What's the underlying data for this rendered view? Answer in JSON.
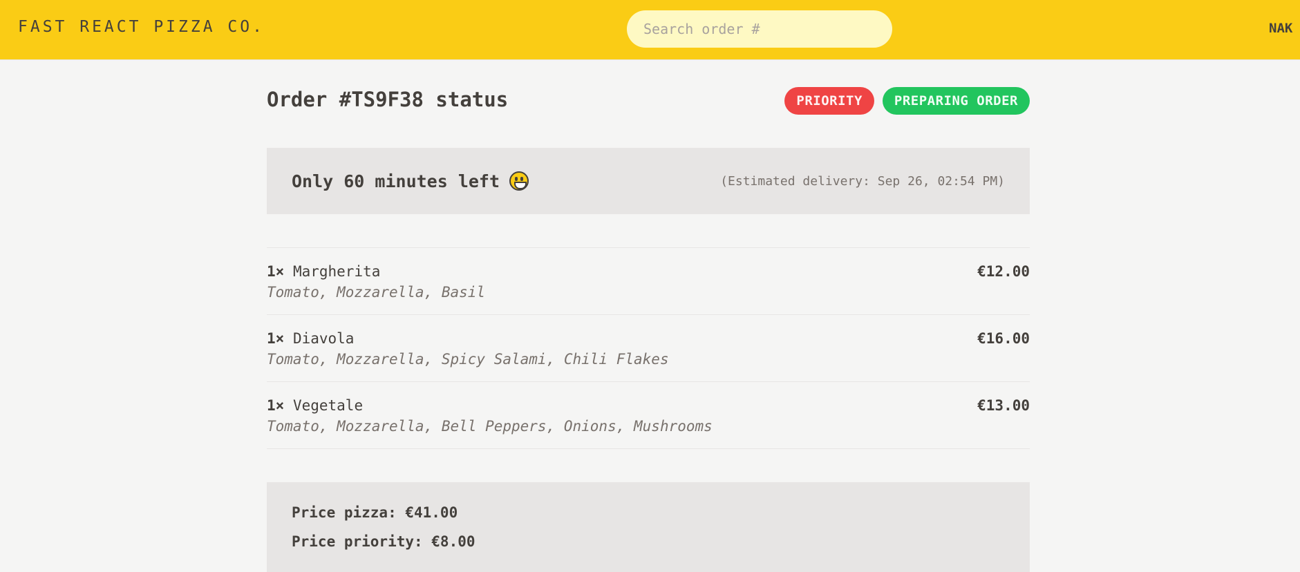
{
  "header": {
    "logo": "Fast React Pizza Co.",
    "search_placeholder": "Search order #",
    "username": "NAK"
  },
  "order": {
    "title": "Order #TS9F38 status",
    "badges": {
      "priority": "Priority",
      "status": "Preparing order"
    },
    "eta": {
      "text": "Only 60 minutes left",
      "icon": "smiley-icon",
      "estimate": "(Estimated delivery: Sep 26, 02:54 PM)"
    },
    "items": [
      {
        "qty": "1×",
        "name": "Margherita",
        "ingredients": "Tomato, Mozzarella, Basil",
        "price": "€12.00"
      },
      {
        "qty": "1×",
        "name": "Diavola",
        "ingredients": "Tomato, Mozzarella, Spicy Salami, Chili Flakes",
        "price": "€16.00"
      },
      {
        "qty": "1×",
        "name": "Vegetale",
        "ingredients": "Tomato, Mozzarella, Bell Peppers, Onions, Mushrooms",
        "price": "€13.00"
      }
    ],
    "totals": {
      "pizza": "Price pizza: €41.00",
      "priority": "Price priority: €8.00"
    }
  },
  "colors": {
    "header_bg": "#facc15",
    "search_bg": "#fef9c3",
    "priority_badge": "#ef4444",
    "status_badge": "#22c55e",
    "panel_bg": "#e7e5e4"
  }
}
